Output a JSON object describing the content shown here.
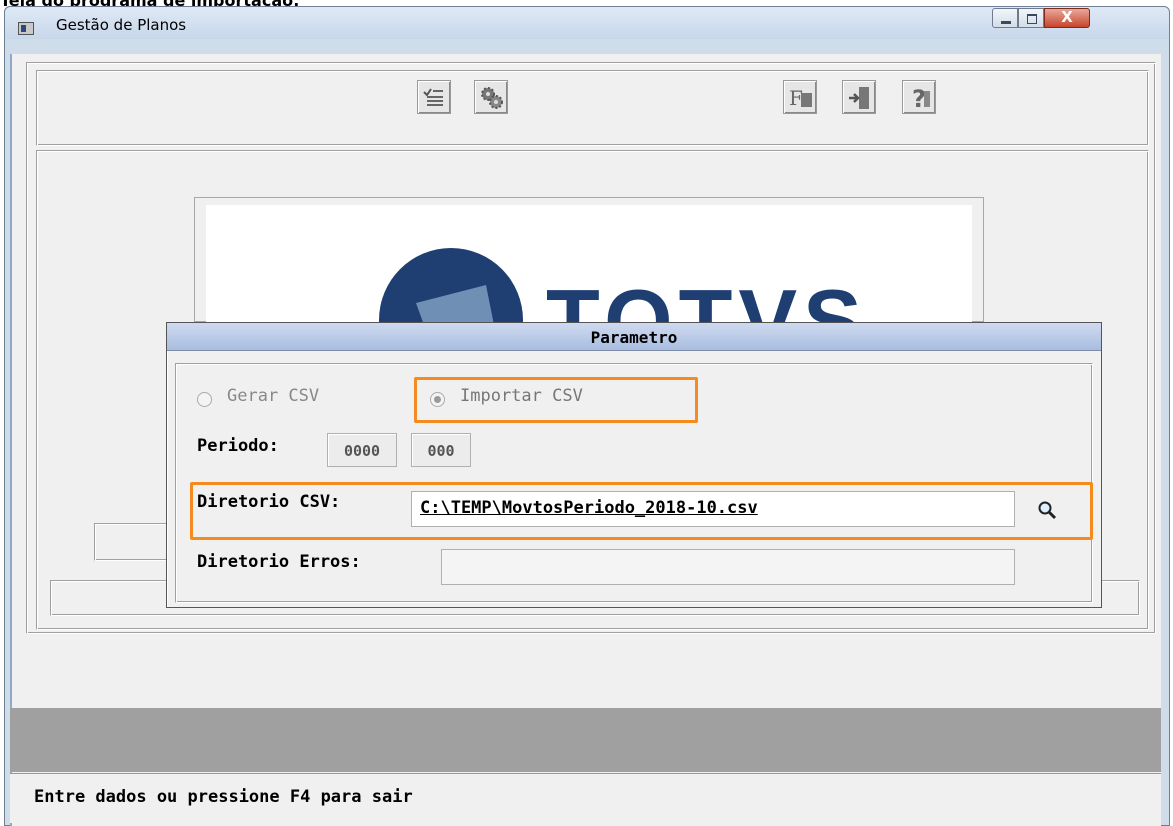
{
  "doc_caption": "Tela do programa de importação:",
  "window": {
    "title": "Gestão de Planos",
    "close_glyph": "X"
  },
  "toolbar": {
    "left_icons": [
      "checklist-icon",
      "gears-icon"
    ],
    "right_icons": [
      "function-key-icon",
      "exit-door-icon",
      "help-icon"
    ]
  },
  "logo": {
    "text": "TOTVS"
  },
  "dialog": {
    "title": "Parametro",
    "radio_gerar": "Gerar CSV",
    "radio_importar": "Importar CSV",
    "selected_option": "Importar CSV",
    "periodo_label": "Periodo:",
    "periodo_year": "0000",
    "periodo_month": "000",
    "dir_csv_label": "Diretorio CSV:",
    "dir_csv_value": "C:\\TEMP\\MovtosPeriodo_2018-10.csv",
    "dir_erros_label": "Diretorio Erros:",
    "dir_erros_value": "",
    "search_icon": "magnifier-icon"
  },
  "status_bar": {
    "message": "Entre dados ou pressione F4 para sair"
  },
  "colors": {
    "highlight": "#f58a1f",
    "titlebar": "#c7d7ea",
    "dialog_title": "#a9bde0",
    "gray_band": "#a0a0a0"
  }
}
